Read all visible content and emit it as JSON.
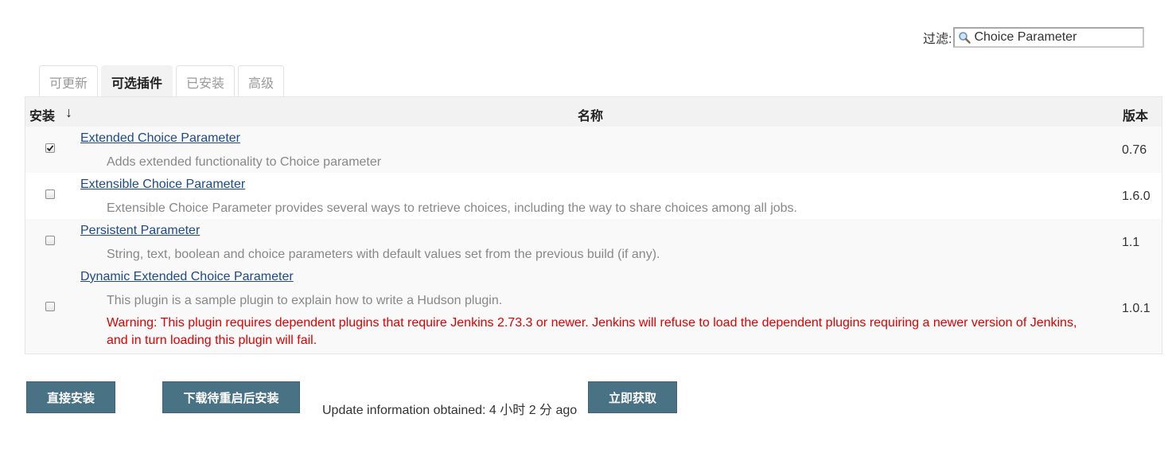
{
  "filter": {
    "label": "过滤:",
    "value": "Choice Parameter",
    "icon": "search-icon"
  },
  "tabs": [
    {
      "label": "可更新",
      "active": false
    },
    {
      "label": "可选插件",
      "active": true
    },
    {
      "label": "已安装",
      "active": false
    },
    {
      "label": "高级",
      "active": false
    }
  ],
  "table": {
    "headers": {
      "install": "安装",
      "sort_arrow": "↓",
      "name": "名称",
      "version": "版本"
    },
    "rows": [
      {
        "checked": true,
        "name": "Extended Choice Parameter",
        "description": "Adds extended functionality to Choice parameter",
        "version": "0.76"
      },
      {
        "checked": false,
        "name": "Extensible Choice Parameter",
        "description": "Extensible Choice Parameter provides several ways to retrieve choices, including the way to share choices among all jobs.",
        "version": "1.6.0"
      },
      {
        "checked": false,
        "name": "Persistent Parameter",
        "description": "String, text, boolean and choice parameters with default values set from the previous build (if any).",
        "version": "1.1"
      },
      {
        "checked": false,
        "name": "Dynamic Extended Choice Parameter",
        "description": "This plugin is a sample plugin to explain how to write a Hudson plugin.",
        "warning": "Warning: This plugin requires dependent plugins that require Jenkins 2.73.3 or newer. Jenkins will refuse to load the dependent plugins requiring a newer version of Jenkins, and in turn loading this plugin will fail.",
        "version": "1.0.1"
      }
    ]
  },
  "actions": {
    "install_now": "直接安装",
    "download_restart": "下载待重启后安装",
    "update_info": "Update information obtained: 4 小时 2 分 ago",
    "check_now": "立即获取"
  },
  "colors": {
    "button_bg": "#4a7285",
    "link": "#204a87",
    "warning": "#e00000",
    "header_bg": "#f2f2f2"
  }
}
